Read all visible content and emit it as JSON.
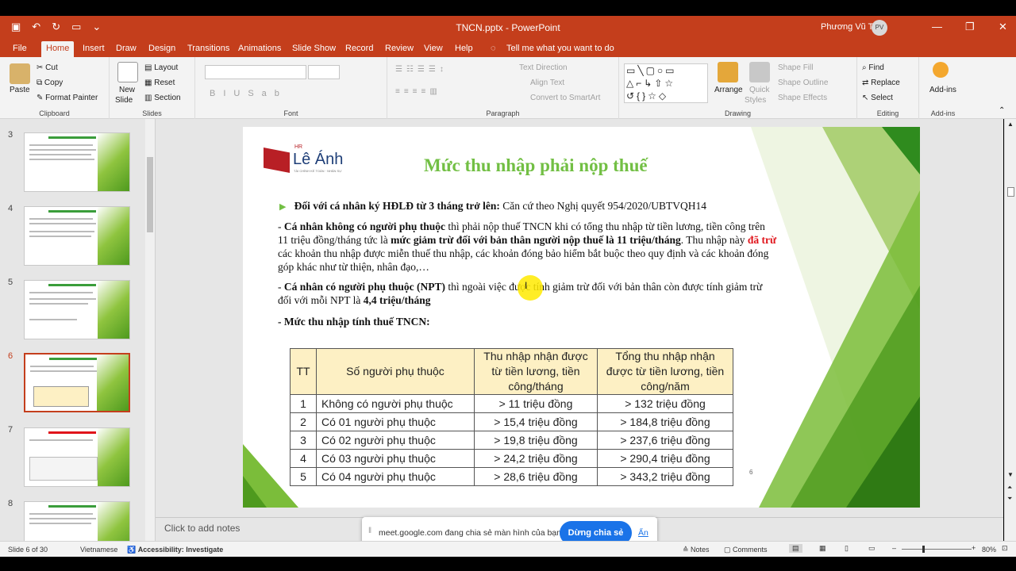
{
  "window": {
    "title": "TNCN.pptx  -  PowerPoint",
    "user": "Phương Vũ Thị",
    "avatar": "PV"
  },
  "tabs": [
    "File",
    "Home",
    "Insert",
    "Draw",
    "Design",
    "Transitions",
    "Animations",
    "Slide Show",
    "Record",
    "Review",
    "View",
    "Help"
  ],
  "tell_me": "Tell me what you want to do",
  "ribbon": {
    "clipboard": {
      "label": "Clipboard",
      "paste": "Paste",
      "cut": "Cut",
      "copy": "Copy",
      "format_painter": "Format Painter"
    },
    "slides": {
      "label": "Slides",
      "new_slide": "New",
      "new_slide2": "Slide",
      "layout": "Layout",
      "reset": "Reset",
      "section": "Section"
    },
    "font": {
      "label": "Font"
    },
    "paragraph": {
      "label": "Paragraph",
      "text_direction": "Text Direction",
      "align_text": "Align Text",
      "smartart": "Convert to SmartArt"
    },
    "drawing": {
      "label": "Drawing",
      "arrange": "Arrange",
      "quick_styles": "Quick",
      "quick_styles2": "Styles",
      "shape_fill": "Shape Fill",
      "shape_outline": "Shape Outline",
      "shape_effects": "Shape Effects"
    },
    "editing": {
      "label": "Editing",
      "find": "Find",
      "replace": "Replace",
      "select": "Select"
    },
    "addins": {
      "label": "Add-ins",
      "button": "Add-ins"
    }
  },
  "thumbnails": [
    {
      "num": "3"
    },
    {
      "num": "4"
    },
    {
      "num": "5"
    },
    {
      "num": "6"
    },
    {
      "num": "7"
    },
    {
      "num": "8"
    }
  ],
  "slide": {
    "logo_small": "HR",
    "logo": "Lê Ánh",
    "logo_tagline": "TÀI CHÍNH KẾ TOÁN · NHÂN SỰ",
    "title": "Mức thu nhập phải nộp thuế",
    "bullet_bold": "Đối với cá nhân ký HĐLĐ từ 3 tháng trở lên:",
    "bullet_rest": " Căn cứ theo Nghị quyết 954/2020/UBTVQH14",
    "p1_a": "- ",
    "p1_b": "Cá nhân không có người phụ thuộc",
    "p1_c": " thì phải nộp thuế TNCN khi có tổng thu nhập từ tiền lương, tiền công trên 11 triệu đồng/tháng tức là ",
    "p1_d": "mức giảm trừ đối với bản thân người nộp thuế là 11 triệu/tháng",
    "p1_e": ". Thu nhập này ",
    "p1_f": "đã trừ",
    "p1_g": " các khoản thu nhập được miễn thuế thu nhập, các khoản đóng bảo hiểm bắt buộc theo quy định và các khoản đóng góp khác như từ thiện, nhân đạo,…",
    "p2_a": "- ",
    "p2_b": "Cá nhân có người phụ thuộc (NPT)",
    "p2_c": " thì ngoài việc được tính giảm trừ đối với bản thân còn được tính giảm trừ đối với mỗi NPT là ",
    "p2_d": "4,4 triệu/tháng",
    "p3": "- Mức thu nhập tính thuế TNCN:",
    "page_number": "6",
    "table": {
      "headers": [
        "TT",
        "Số người phụ thuộc",
        "Thu nhập nhận được từ tiền lương, tiền công/tháng",
        "Tổng thu nhập nhận được từ tiền lương, tiền công/năm"
      ],
      "rows": [
        [
          "1",
          "Không có người phụ thuộc",
          "> 11 triệu đồng",
          "> 132 triệu đồng"
        ],
        [
          "2",
          "Có 01 người phụ thuộc",
          "> 15,4 triệu đồng",
          "> 184,8 triệu đồng"
        ],
        [
          "3",
          "Có 02 người phụ thuộc",
          "> 19,8 triệu đồng",
          "> 237,6 triệu đồng"
        ],
        [
          "4",
          "Có 03 người phụ thuộc",
          "> 24,2 triệu đồng",
          "> 290,4 triệu đồng"
        ],
        [
          "5",
          "Có 04 người phụ thuộc",
          "> 28,6 triệu đồng",
          "> 343,2 triệu đồng"
        ]
      ]
    }
  },
  "notes_placeholder": "Click to add notes",
  "share_bar": {
    "text": "meet.google.com đang chia sẻ màn hình của bạn.",
    "stop": "Dừng chia sẻ",
    "hide": "Ẩn"
  },
  "status": {
    "slide": "Slide 6 of 30",
    "language": "Vietnamese",
    "accessibility": "Accessibility: Investigate",
    "notes": "Notes",
    "comments": "Comments",
    "zoom": "80%"
  }
}
